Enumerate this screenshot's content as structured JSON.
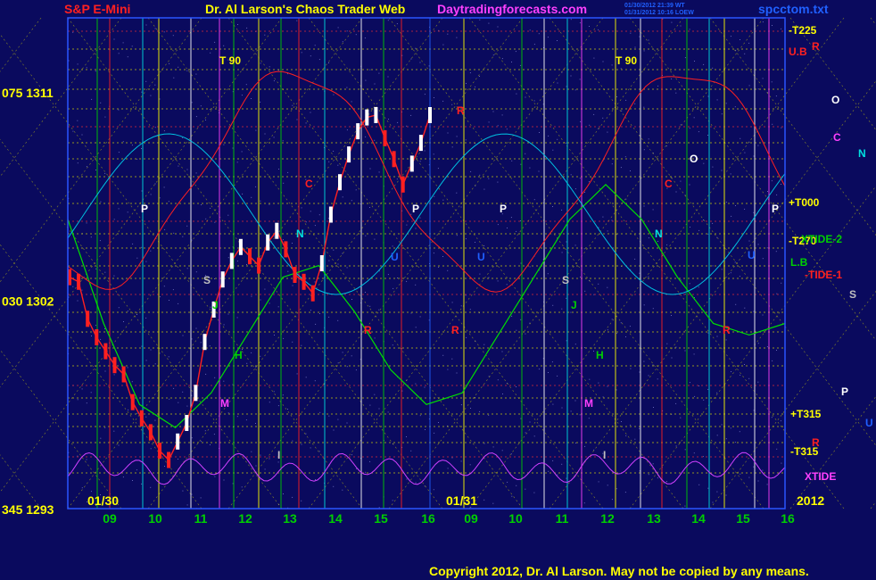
{
  "header": {
    "symbol": "S&P E-Mini",
    "title": "Dr. Al Larson's Chaos Trader Web",
    "site": "Daytradingforecasts.com",
    "stamp1": "01/30/2012 21:39 WT",
    "stamp2": "01/31/2012 10:16 LOEW",
    "file": "spcctom.txt"
  },
  "footer": {
    "copyright": "Copyright 2012, Dr. Al Larson. May not be copied by any means."
  },
  "colors": {
    "bg": "#0a0a5e",
    "plot_border": "#2a55ff",
    "yellow": "#ffff00",
    "white": "#ffffff",
    "red": "#ff2020",
    "green": "#00d000",
    "cyan": "#00e0e0",
    "magenta": "#ff40ff",
    "blue": "#2060ff"
  },
  "chart_data": {
    "type": "line",
    "title": "S&P E-Mini",
    "y_ticks": [
      {
        "label": "075 1311",
        "value": 1311
      },
      {
        "label": "030 1302",
        "value": 1302
      },
      {
        "label": "345 1293",
        "value": 1293
      }
    ],
    "ylim": [
      1293,
      1314.2
    ],
    "x_hour_labels": [
      "09",
      "10",
      "11",
      "12",
      "13",
      "14",
      "15",
      "16",
      "09",
      "10",
      "11",
      "12",
      "13",
      "14",
      "15",
      "16"
    ],
    "date_labels": [
      "01/30",
      "01/31",
      "2012"
    ],
    "right_labels": [
      "-T225",
      "+T000",
      "-T270",
      "+T315",
      "-T315",
      "XTIDE-2",
      "-TIDE-1",
      "U.B",
      "L.B",
      "XTIDE",
      "R",
      "R"
    ],
    "point_labels": [
      "T  90",
      "T  90",
      "P",
      "P",
      "P",
      "P",
      "C",
      "C",
      "C",
      "O",
      "O",
      "N",
      "N",
      "N",
      "U",
      "U",
      "U",
      "R",
      "R",
      "R",
      "H",
      "H",
      "J",
      "J",
      "M",
      "M",
      "S",
      "S",
      "S",
      "I",
      "I",
      "P",
      "R",
      "U"
    ],
    "price_series": {
      "name": "S&P E-Mini",
      "x": [
        0,
        2,
        4,
        6,
        8,
        10,
        12,
        14,
        16,
        18,
        20,
        22,
        24,
        26,
        28,
        30,
        32,
        34,
        36,
        38,
        40,
        42,
        44,
        46,
        48,
        50,
        52,
        54,
        56,
        58,
        60,
        62,
        64,
        66,
        68,
        70,
        72,
        74,
        76,
        78,
        80
      ],
      "y": [
        1303.0,
        1302.8,
        1301.2,
        1300.4,
        1299.8,
        1299.2,
        1298.8,
        1297.6,
        1296.9,
        1296.3,
        1295.5,
        1295.1,
        1295.9,
        1296.7,
        1298.0,
        1300.2,
        1301.6,
        1302.9,
        1303.7,
        1304.3,
        1303.9,
        1303.5,
        1304.5,
        1305.0,
        1304.2,
        1303.1,
        1302.8,
        1302.3,
        1303.6,
        1305.7,
        1307.1,
        1308.3,
        1309.3,
        1309.9,
        1310.0,
        1309.0,
        1308.1,
        1307.0,
        1307.9,
        1308.8,
        1310.0
      ]
    },
    "forecast_series": {
      "name": "Chaos Clock forecast",
      "x": [
        0,
        8,
        16,
        24,
        32,
        40,
        48,
        56,
        64,
        72,
        80,
        88,
        96,
        104,
        112,
        120,
        128,
        136,
        144,
        152,
        160
      ],
      "y": [
        1305.5,
        1301.0,
        1297.5,
        1296.5,
        1298.0,
        1300.5,
        1303.0,
        1303.5,
        1301.5,
        1299.0,
        1297.5,
        1298.0,
        1300.5,
        1303.0,
        1305.5,
        1307.0,
        1305.5,
        1303.0,
        1301.0,
        1300.5,
        1301.0
      ]
    }
  }
}
